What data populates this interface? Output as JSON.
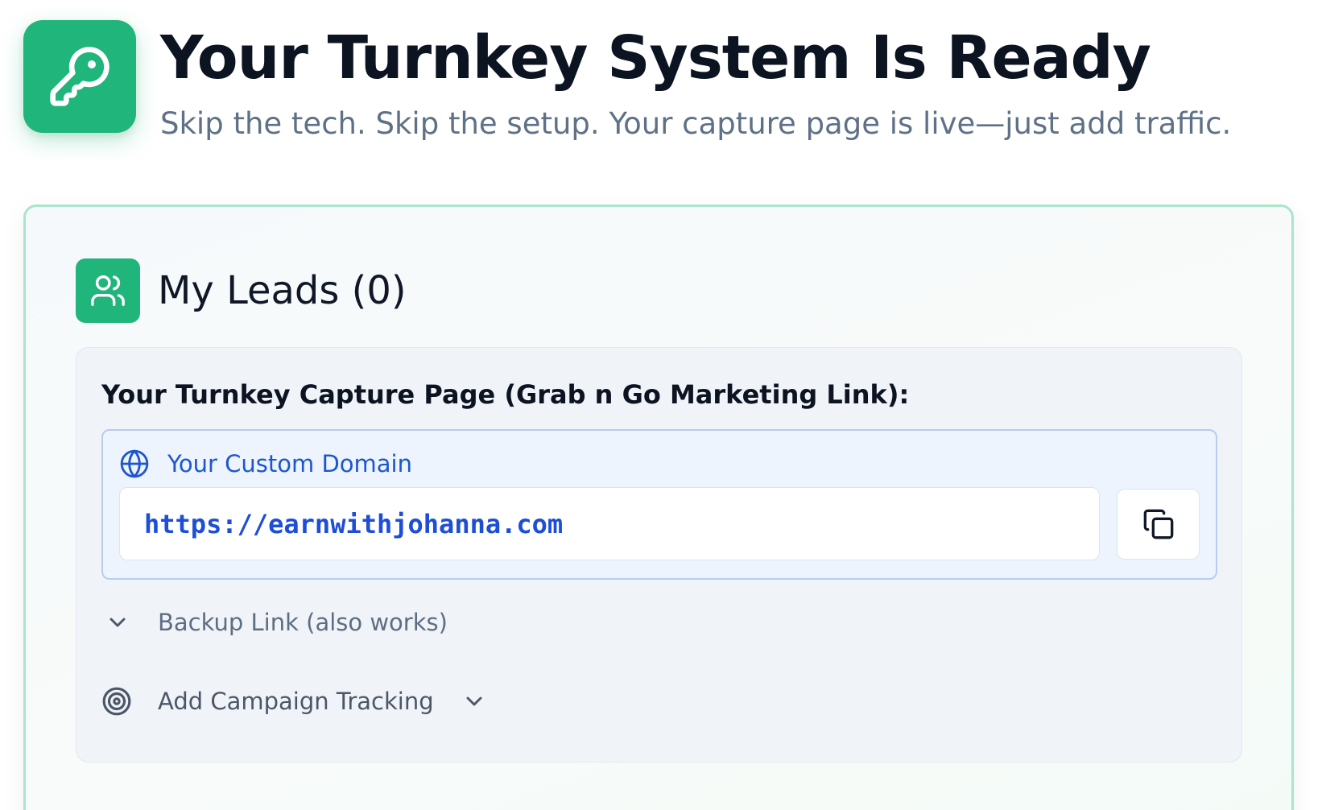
{
  "header": {
    "title": "Your Turnkey System Is Ready",
    "subtitle": "Skip the tech. Skip the setup. Your capture page is live—just add traffic.",
    "icon": "key-icon"
  },
  "leads": {
    "title": "My Leads (0)",
    "icon": "users-icon",
    "capture_page_label": "Your Turnkey Capture Page (Grab n Go Marketing Link):",
    "custom_domain": {
      "label": "Your Custom Domain",
      "icon": "globe-icon",
      "url": "https://earnwithjohanna.com",
      "copy_icon": "copy-icon"
    },
    "backup_link": {
      "label": "Backup Link (also works)",
      "icon": "chevron-down-icon"
    },
    "campaign_tracking": {
      "label": "Add Campaign Tracking",
      "icon": "target-icon",
      "toggle_icon": "chevron-down-icon"
    }
  },
  "colors": {
    "accent": "#1fb57b",
    "card_border": "#a9e6cb",
    "link_blue": "#1d56cf",
    "title": "#0c1321",
    "subtitle": "#5f7186"
  }
}
